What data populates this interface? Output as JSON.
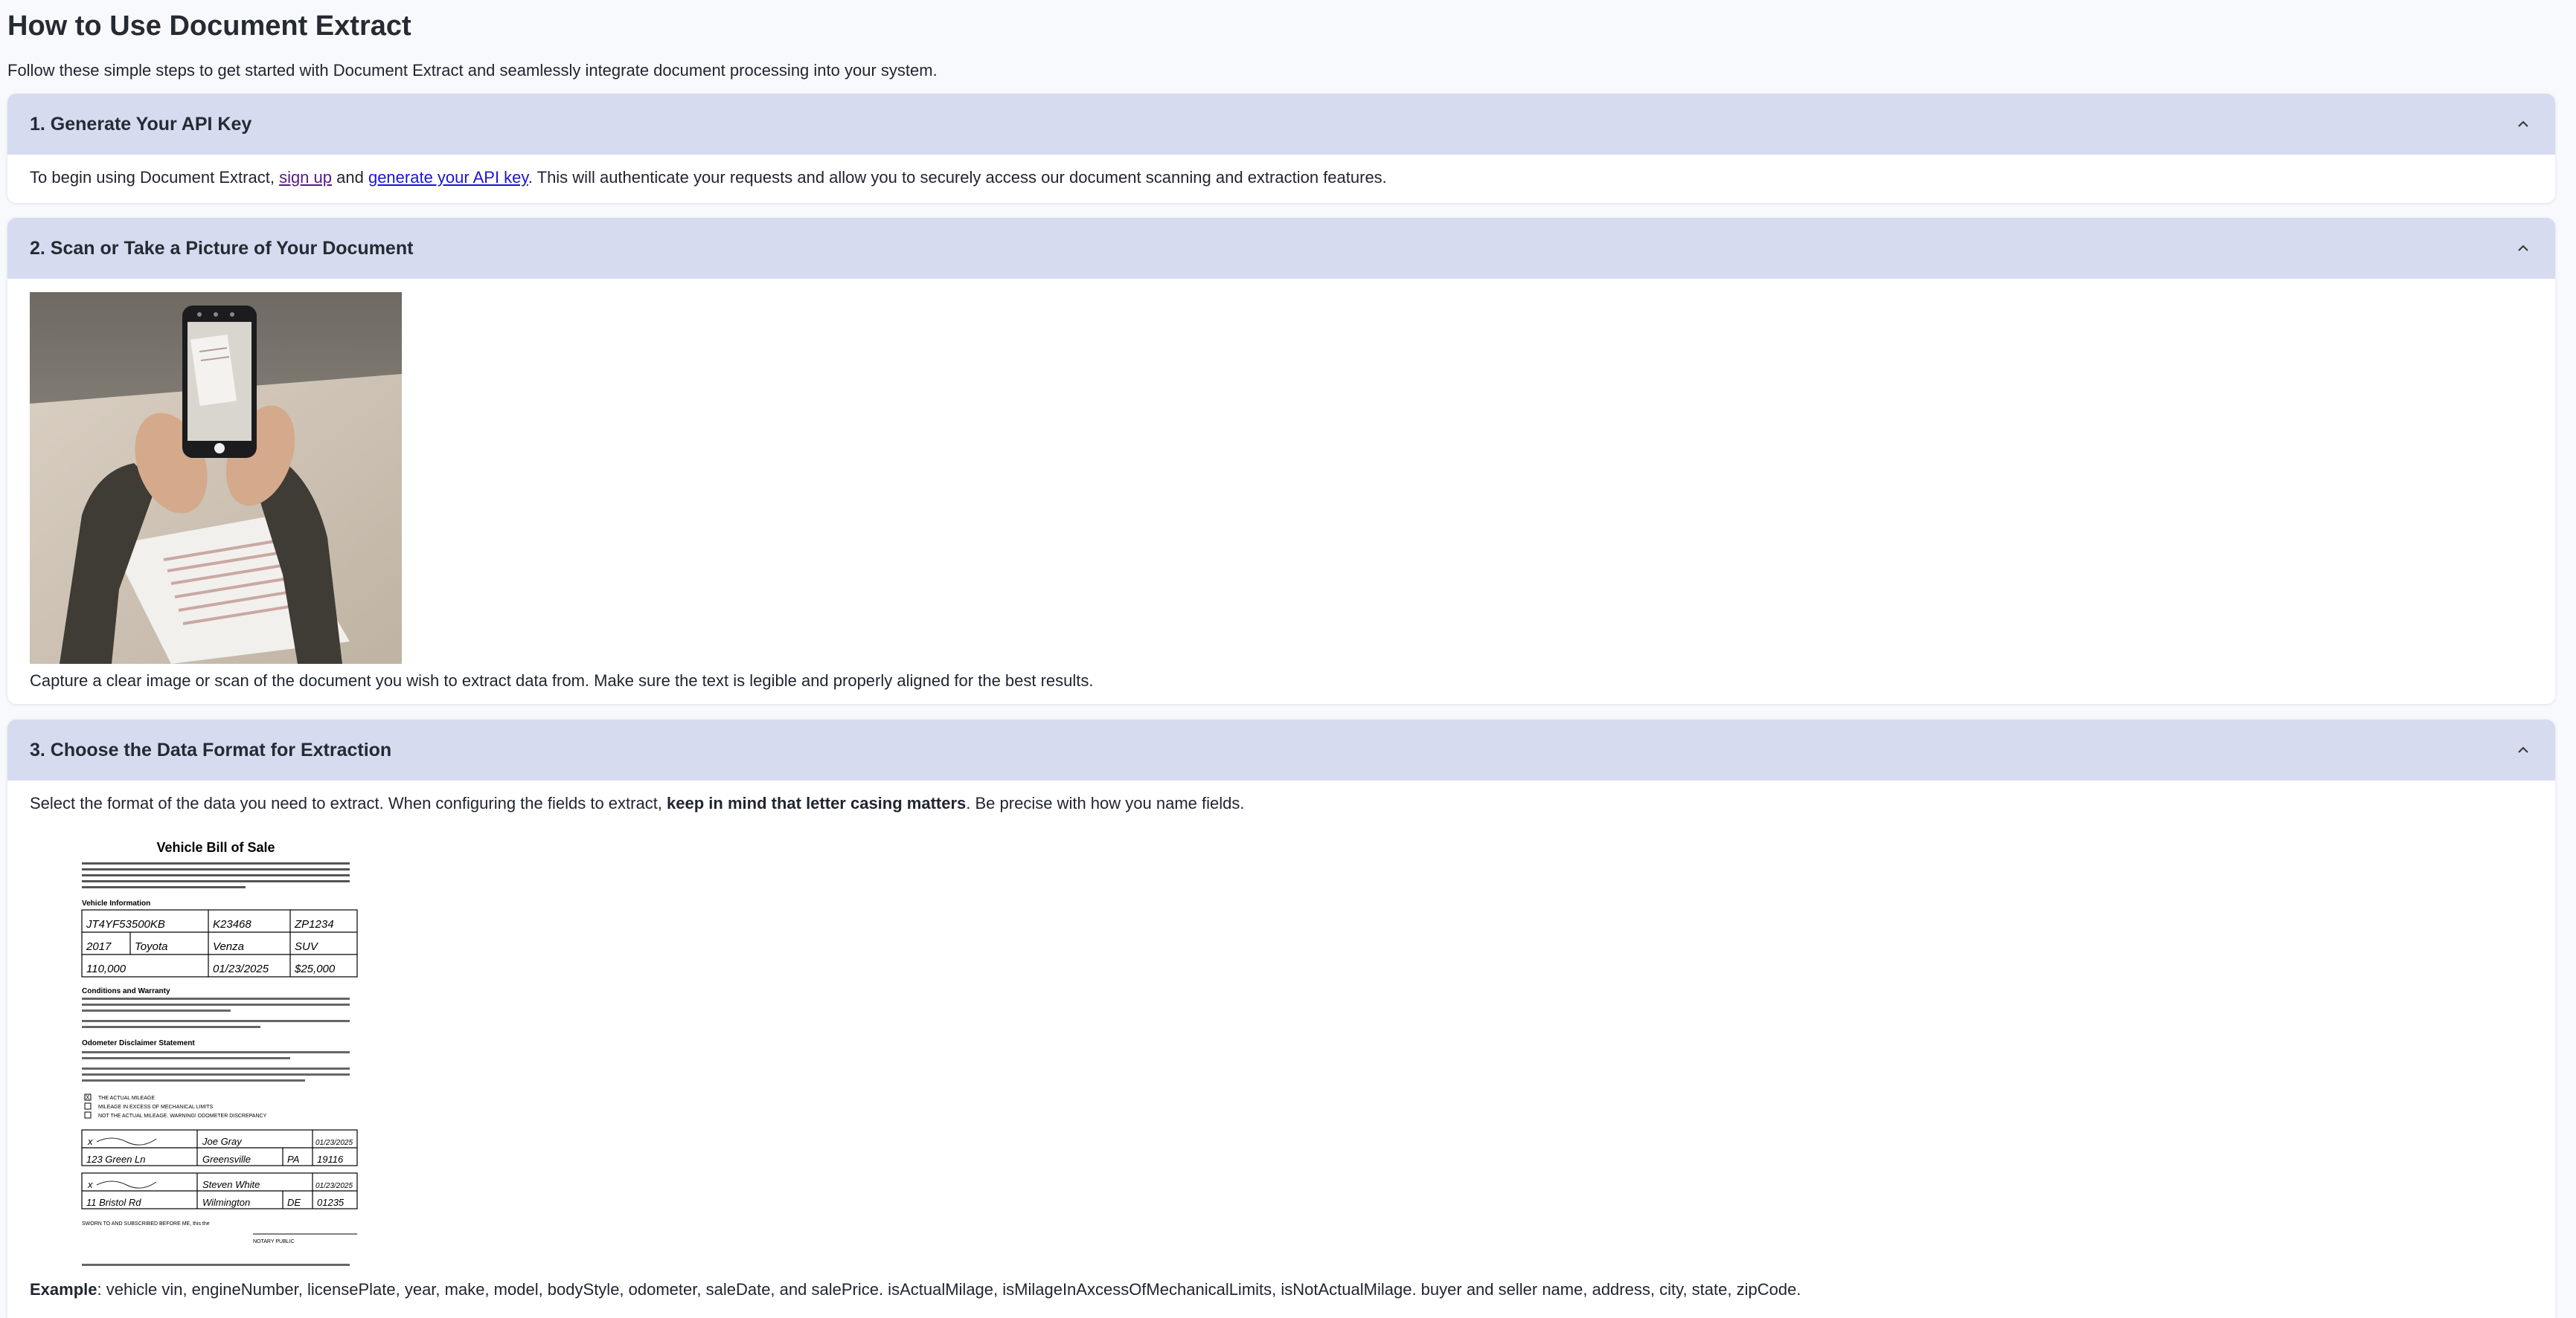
{
  "page": {
    "title": "How to Use Document Extract",
    "subtitle": "Follow these simple steps to get started with Document Extract and seamlessly integrate document processing into your system."
  },
  "steps": [
    {
      "title": "1. Generate Your API Key",
      "text_before": "To begin using Document Extract, ",
      "link1": "sign up",
      "text_middle": " and ",
      "link2": "generate your API key",
      "text_after": ". This will authenticate your requests and allow you to securely access our document scanning and extraction features."
    },
    {
      "title": "2. Scan or Take a Picture of Your Document",
      "caption": "Capture a clear image or scan of the document you wish to extract data from. Make sure the text is legible and properly aligned for the best results."
    },
    {
      "title": "3. Choose the Data Format for Extraction",
      "intro_before": "Select the format of the data you need to extract. When configuring the fields to extract, ",
      "intro_bold": "keep in mind that letter casing matters",
      "intro_after": ". Be precise with how you name fields.",
      "example_label": "Example",
      "example_text": ": vehicle vin, engineNumber, licensePlate, year, make, model, bodyStyle, odometer, saleDate, and salePrice. isActualMilage, isMilageInAxcessOfMechanicalLimits, isNotActualMilage. buyer and seller name, address, city, state, zipCode."
    }
  ],
  "bill_of_sale": {
    "title": "Vehicle Bill of Sale",
    "section_vehicle": "Vehicle Information",
    "section_conditions": "Conditions and Warranty",
    "section_odometer": "Odometer Disclaimer Statement",
    "vin": "JT4YF53500KB",
    "engine": "K23468",
    "plate": "ZP1234",
    "year": "2017",
    "make": "Toyota",
    "model": "Venza",
    "body": "SUV",
    "odometer": "110,000",
    "sale_date": "01/23/2025",
    "price": "$25,000",
    "check_actual": "THE ACTUAL MILEAGE",
    "check_excess": "MILEAGE IN EXCESS OF MECHANICAL LIMITS",
    "check_not": "NOT THE ACTUAL MILEAGE. WARNING! ODOMETER DISCREPANCY",
    "seller_name": "Joe Gray",
    "seller_date": "01/23/2025",
    "seller_address": "123 Green Ln",
    "seller_city": "Greensville",
    "seller_state": "PA",
    "seller_zip": "19116",
    "buyer_name": "Steven White",
    "buyer_date": "01/23/2025",
    "buyer_address": "11 Bristol Rd",
    "buyer_city": "Wilmington",
    "buyer_state": "DE",
    "buyer_zip": "01235",
    "sworn": "SWORN TO AND SUBSCRIBED BEFORE ME, this the",
    "notary": "NOTARY PUBLIC"
  },
  "icons": {
    "chevron": "chevron-up-icon"
  },
  "colors": {
    "header_bg": "#d6dbf0",
    "link": "#1a14d8",
    "page_bg": "#f8f9fc"
  }
}
